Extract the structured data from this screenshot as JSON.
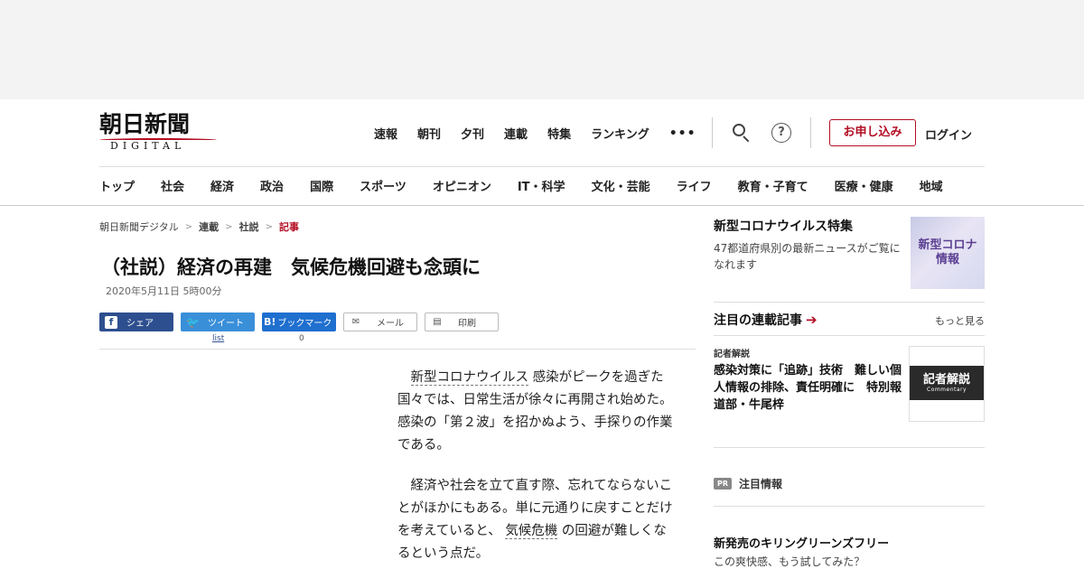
{
  "header": {
    "logo_kanji": "朝日新聞",
    "logo_sub": "DIGITAL",
    "main_nav": [
      "速報",
      "朝刊",
      "夕刊",
      "連載",
      "特集",
      "ランキング"
    ],
    "more": "•••",
    "subscribe_label": "お申し込み",
    "login_label": "ログイン",
    "help_glyph": "?"
  },
  "category_nav": [
    "トップ",
    "社会",
    "経済",
    "政治",
    "国際",
    "スポーツ",
    "オピニオン",
    "IT・科学",
    "文化・芸能",
    "ライフ",
    "教育・子育て",
    "医療・健康",
    "地域"
  ],
  "breadcrumb": {
    "items": [
      "朝日新聞デジタル",
      "連載",
      "社説"
    ],
    "current": "記事",
    "separator": ">"
  },
  "article": {
    "title": "（社説）経済の再建　気候危機回避も念頭に",
    "date": "2020年5月11日 5時00分",
    "para1_kw": "新型コロナウイルス",
    "para1_rest": "感染がピークを過ぎた国々では、日常生活が徐々に再開され始めた。感染の「第２波」を招かぬよう、手探りの作業である。",
    "para2_before": "経済や社会を立て直す際、忘れてならないことがほかにもある。単に元通りに戻すことだけを考えていると、",
    "para2_kw": "気候危機",
    "para2_after": "の回避が難しくなるという点だ。"
  },
  "share": {
    "facebook": {
      "glyph": "f",
      "label": "シェア"
    },
    "twitter": {
      "glyph": "🐦",
      "label": "ツイート",
      "count": "list"
    },
    "hatena": {
      "glyph": "B!",
      "label": "ブックマーク",
      "count": "0"
    },
    "mail": {
      "glyph": "✉",
      "label": "メール"
    },
    "print": {
      "glyph": "▤",
      "label": "印刷"
    }
  },
  "sidebar": {
    "feature": {
      "title": "新型コロナウイルス特集",
      "desc": "47都道府県別の最新ニュースがご覧になれます",
      "img_line1": "新型コロナ",
      "img_line2": "情報"
    },
    "series": {
      "title": "注目の連載記事",
      "more": "もっと見る",
      "label": "記者解説",
      "headline": "感染対策に「追跡」技術　難しい個人情報の排除、責任明確に　特別報道部・牛尾梓",
      "thumb_big": "記者解説",
      "thumb_small": "Commentary"
    },
    "pr": {
      "badge": "PR",
      "title": "注目情報",
      "headline": "新発売のキリングリーンズフリー",
      "sub": "この爽快感、もう試してみた？"
    }
  },
  "colors": {
    "brand_red": "#b30d23",
    "facebook": "#2e4f8f",
    "twitter": "#3a8fd9",
    "hatena": "#1f6fcf"
  }
}
